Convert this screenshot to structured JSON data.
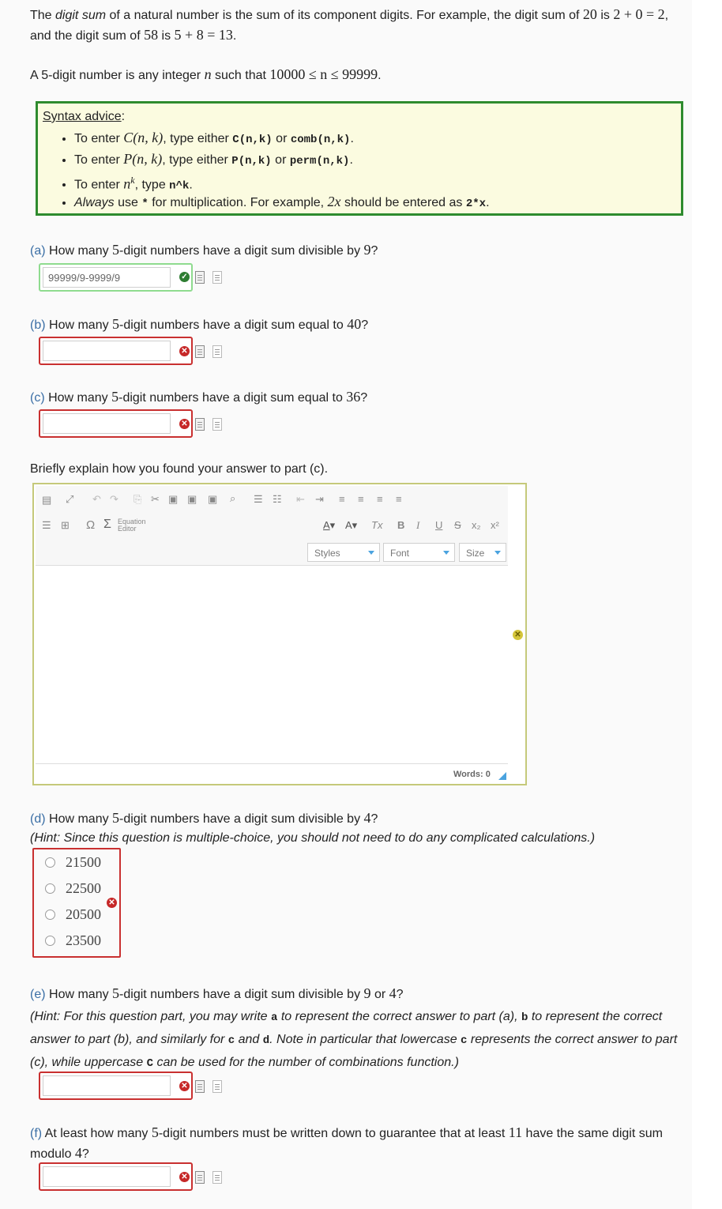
{
  "intro": {
    "p1_a": "The ",
    "p1_b": "digit sum",
    "p1_c": " of a natural number is the sum of its component digits. For example, the digit sum of ",
    "p1_d": "20",
    "p1_e": " is ",
    "p1_f": "2 + 0 = 2",
    "p1_g": ",",
    "p1_h": "and the digit sum of ",
    "p1_i": "58",
    "p1_j": " is ",
    "p1_k": "5 + 8 = 13",
    "p1_l": ".",
    "p2_a": "A 5-digit number is any integer ",
    "p2_b": "n",
    "p2_c": " such that ",
    "p2_d": "10000 ≤ n ≤ 99999",
    "p2_e": "."
  },
  "syntax": {
    "title": "Syntax advice",
    "colon": ":",
    "items": [
      {
        "a": "To enter ",
        "m": "C(n, k)",
        "b": ", type either ",
        "c1": "C(n,k)",
        "or": " or ",
        "c2": "comb(n,k)",
        "end": "."
      },
      {
        "a": "To enter ",
        "m": "P(n, k)",
        "b": ", type either ",
        "c1": "P(n,k)",
        "or": " or ",
        "c2": "perm(n,k)",
        "end": "."
      },
      {
        "a": "To enter ",
        "m": "n",
        "sup": "k",
        "b": ", type ",
        "c1": "n^k",
        "end": "."
      },
      {
        "a_i": "Always",
        "a": " use ",
        "c1": "*",
        "b": " for multiplication. For example, ",
        "m": "2x",
        "c": " should be entered as ",
        "c2": "2*x",
        "end": "."
      }
    ]
  },
  "questions": {
    "a": {
      "label": "(a)",
      "text": " How many ",
      "n": "5",
      "text2": "-digit numbers have a digit sum divisible by ",
      "n2": "9",
      "end": "?",
      "value": "99999/9-9999/9"
    },
    "b": {
      "label": "(b)",
      "text": " How many ",
      "n": "5",
      "text2": "-digit numbers have a digit sum equal to ",
      "n2": "40",
      "end": "?",
      "value": ""
    },
    "c": {
      "label": "(c)",
      "text": " How many ",
      "n": "5",
      "text2": "-digit numbers have a digit sum equal to ",
      "n2": "36",
      "end": "?",
      "value": ""
    },
    "explain": "Briefly explain how you found your answer to part (c).",
    "d": {
      "label": "(d)",
      "text": " How many ",
      "n": "5",
      "text2": "-digit numbers have a digit sum divisible by ",
      "n2": "4",
      "end": "?",
      "hint": "(Hint: Since this question is multiple-choice, you should not need to do any complicated calculations.)",
      "options": [
        "21500",
        "22500",
        "20500",
        "23500"
      ]
    },
    "e": {
      "label": "(e)",
      "text": " How many ",
      "n": "5",
      "text2": "-digit numbers have a digit sum divisible by ",
      "n2": "9",
      "or": " or ",
      "n3": "4",
      "end": "?",
      "hint1": "(Hint: For this question part, you may write ",
      "ha": "a",
      "hint2": " to represent the correct answer to part (a), ",
      "hb": "b",
      "hint3": " to represent the correct",
      "hint4": "answer to part (b), and similarly for ",
      "hc": "c",
      "hint5": " and ",
      "hd": "d",
      "hint6": ". Note in particular that lowercase ",
      "hc2": "c",
      "hint7": " represents the correct answer to part",
      "hint8": "(c), while uppercase ",
      "hC": "C",
      "hint9": " can be used for the number of combinations function.)",
      "value": ""
    },
    "f": {
      "label": "(f)",
      "text": " At least how many ",
      "n": "5",
      "text2": "-digit numbers must be written down to guarantee that at least ",
      "n2": "11",
      "text3": " have the same digit sum",
      "line2": "modulo ",
      "n3": "4",
      "end": "?",
      "value": ""
    }
  },
  "editor": {
    "styles": "Styles",
    "font": "Font",
    "size": "Size",
    "words": "Words: 0",
    "equation_editor_l1": "Equation",
    "equation_editor_l2": "Editor",
    "omega": "Ω",
    "sigma": "Σ",
    "bold": "B",
    "italic": "I",
    "underline": "U",
    "strike": "S",
    "sub": "x₂",
    "sup": "x²",
    "fontcolor": "A",
    "bgcolor": "A",
    "clearfmt": "Tx"
  },
  "colors": {
    "label": "#3a6ea5",
    "ok_border": "#8fdb8f",
    "bad_border": "#c93030",
    "syntax_border": "#2e8b2e",
    "syntax_bg": "#fbfbe0",
    "editor_border": "#c5c97a"
  }
}
